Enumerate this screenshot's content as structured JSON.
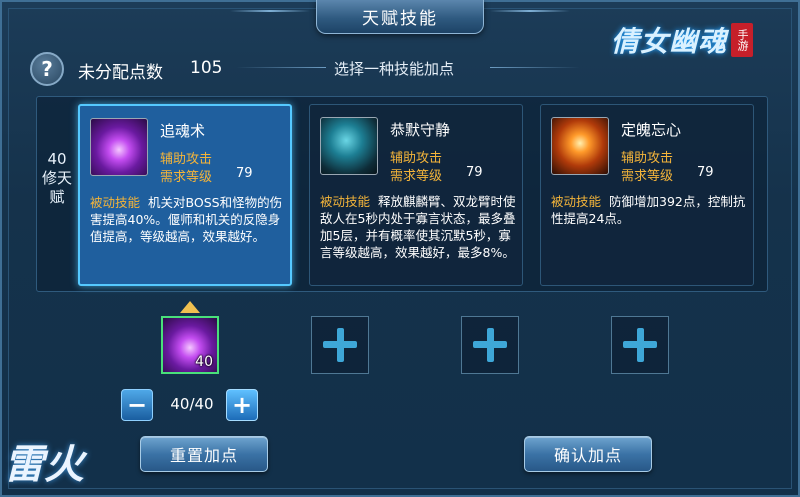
{
  "window": {
    "title": "天赋技能"
  },
  "logo": {
    "text": "倩女幽魂",
    "seal": "手游"
  },
  "header": {
    "points_label": "未分配点数",
    "points_value": "105",
    "choose_label": "选择一种技能加点"
  },
  "tier": {
    "label": "40修天赋"
  },
  "skills": [
    {
      "name": "追魂术",
      "type": "辅助攻击",
      "req_label": "需求等级",
      "req_value": "79",
      "desc_tag": "被动技能",
      "desc": "机关对BOSS和怪物的伤害提高40%。偃师和机关的反隐身值提高，等级越高，效果越好。",
      "icon": "purple-vortex-icon"
    },
    {
      "name": "恭默守静",
      "type": "辅助攻击",
      "req_label": "需求等级",
      "req_value": "79",
      "desc_tag": "被动技能",
      "desc": "释放麒麟臂、双龙臂时使敌人在5秒内处于寡言状态，最多叠加5层，并有概率使其沉默5秒，寡言等级越高，效果越好，最多8%。",
      "icon": "silence-figure-icon"
    },
    {
      "name": "定魄忘心",
      "type": "辅助攻击",
      "req_label": "需求等级",
      "req_value": "79",
      "desc_tag": "被动技能",
      "desc": "防御增加392点，控制抗性提高24点。",
      "icon": "glowing-hands-icon"
    }
  ],
  "slots": [
    {
      "state": "filled",
      "count": "40",
      "icon": "purple-vortex-icon"
    },
    {
      "state": "empty",
      "icon": "plus-icon"
    },
    {
      "state": "empty",
      "icon": "plus-icon"
    },
    {
      "state": "empty",
      "icon": "plus-icon"
    }
  ],
  "stepper": {
    "value": "40/40",
    "minus": "−",
    "plus": "+"
  },
  "buttons": {
    "reset": "重置加点",
    "confirm": "确认加点"
  },
  "watermark": {
    "text": "雷火"
  },
  "colors": {
    "accent_gold": "#f3b43a",
    "selected_border": "#55c9ff",
    "plus": "#3ea7d8"
  }
}
